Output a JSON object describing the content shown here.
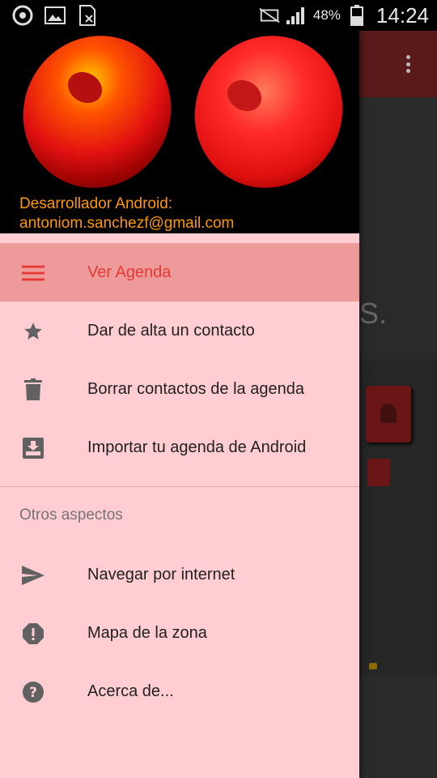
{
  "status_bar": {
    "battery_percent": "48%",
    "time": "14:24",
    "icons": [
      "notification-app-icon",
      "image-icon",
      "sim-card-icon",
      "mute-icon",
      "signal-icon",
      "battery-icon"
    ]
  },
  "drawer": {
    "header": {
      "line1": "Desarrollador Android:",
      "line2": "antoniom.sanchezf@gmail.com"
    },
    "items": [
      {
        "label": "Ver Agenda",
        "icon": "menu-icon",
        "active": true
      },
      {
        "label": "Dar de alta un contacto",
        "icon": "star-icon"
      },
      {
        "label": "Borrar contactos de la agenda",
        "icon": "trash-icon"
      },
      {
        "label": "Importar tu agenda de Android",
        "icon": "import-icon"
      }
    ],
    "section_title": "Otros aspectos",
    "other_items": [
      {
        "label": "Navegar por internet",
        "icon": "send-icon"
      },
      {
        "label": "Mapa de la zona",
        "icon": "alert-icon"
      },
      {
        "label": "Acerca de...",
        "icon": "help-icon"
      }
    ]
  },
  "background": {
    "visible_text": "S."
  },
  "colors": {
    "drawer_bg": "#ffcdd2",
    "active_bg": "#ef9a9a",
    "accent": "#e53935",
    "header_text": "#ff9800"
  }
}
